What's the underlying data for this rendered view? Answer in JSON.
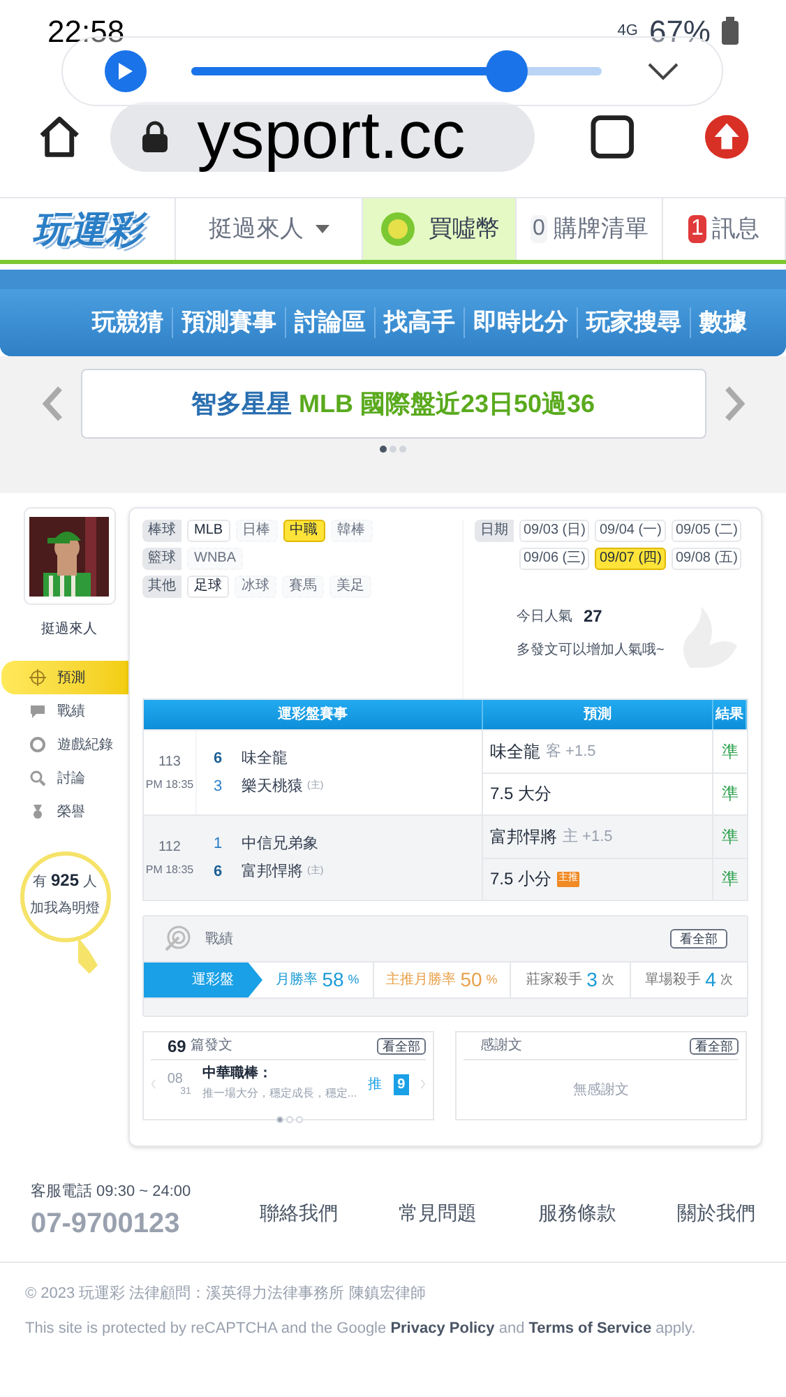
{
  "status_bar": {
    "time": "22:58",
    "network": "4G",
    "battery": "67%"
  },
  "media_player": {
    "level": 0.77
  },
  "browser": {
    "url": "ysport.cc"
  },
  "header": {
    "logo": "玩運彩",
    "user_menu": "挺過來人",
    "buy_coins": "買噓幣",
    "cart": {
      "count": "0",
      "label": "購牌清單"
    },
    "messages": {
      "count": "1",
      "label": "訊息"
    }
  },
  "main_nav": [
    "玩競猜",
    "預測賽事",
    "討論區",
    "找高手",
    "即時比分",
    "玩家搜尋",
    "數據"
  ],
  "banner": {
    "text": "智多星星 **MLB 國際盤近23日50過36**",
    "dots": [
      {
        "selected": true
      },
      {
        "selected": false
      },
      {
        "selected": false
      }
    ]
  },
  "profile": {
    "name": "挺過來人"
  },
  "sidebar": [
    {
      "label": "預測",
      "kind": "target",
      "selected": true
    },
    {
      "label": "戰績",
      "kind": "chat",
      "selected": false
    },
    {
      "label": "遊戲紀錄",
      "kind": "ring",
      "selected": false
    },
    {
      "label": "討論",
      "kind": "search",
      "selected": false
    },
    {
      "label": "榮譽",
      "kind": "medal",
      "selected": false
    }
  ],
  "fans": {
    "prefix": "有",
    "count": "925",
    "suffix": "人",
    "action": "加我為明燈"
  },
  "filters": [
    {
      "label": "棒球",
      "options": [
        {
          "label": "MLB",
          "disabled": false,
          "selected": false
        },
        {
          "label": "日棒",
          "disabled": true,
          "selected": false
        },
        {
          "label": "中職",
          "disabled": false,
          "selected": true
        },
        {
          "label": "韓棒",
          "disabled": true,
          "selected": false
        }
      ]
    },
    {
      "label": "籃球",
      "options": [
        {
          "label": "WNBA",
          "disabled": true,
          "selected": false
        }
      ]
    },
    {
      "label": "其他",
      "options": [
        {
          "label": "足球",
          "disabled": false,
          "selected": false
        },
        {
          "label": "冰球",
          "disabled": true,
          "selected": false
        },
        {
          "label": "賽馬",
          "disabled": true,
          "selected": false
        },
        {
          "label": "美足",
          "disabled": true,
          "selected": false
        }
      ]
    }
  ],
  "dates": {
    "label": "日期",
    "items": [
      {
        "label": "09/03 (日)",
        "selected": false
      },
      {
        "label": "09/04 (一)",
        "selected": false
      },
      {
        "label": "09/05 (二)",
        "selected": false
      },
      {
        "label": "09/06 (三)",
        "selected": false
      },
      {
        "label": "09/07 (四)",
        "selected": true
      },
      {
        "label": "09/08 (五)",
        "selected": false
      }
    ]
  },
  "popularity": {
    "label": "今日人氣",
    "value": "27",
    "hint": "多發文可以增加人氣哦~"
  },
  "predictions": {
    "columns": [
      "運彩盤賽事",
      "預測",
      "結果"
    ],
    "games": [
      {
        "number": "113",
        "time": "PM 18:35",
        "teams": [
          {
            "score": "6",
            "name": "味全龍",
            "winner": true
          },
          {
            "score": "3",
            "name": "樂天桃猿",
            "winner": false,
            "home_mark": "(主)"
          }
        ],
        "picks": [
          {
            "pick": "味全龍",
            "note": "客 +1.5",
            "result": "準"
          },
          {
            "pick": "7.5 大分",
            "result": "準"
          }
        ]
      },
      {
        "number": "112",
        "time": "PM 18:35",
        "teams": [
          {
            "score": "1",
            "name": "中信兄弟象",
            "winner": false
          },
          {
            "score": "6",
            "name": "富邦悍將",
            "winner": true,
            "home_mark": "(主)"
          }
        ],
        "picks": [
          {
            "pick": "富邦悍將",
            "note": "主 +1.5",
            "result": "準"
          },
          {
            "pick": "7.5 小分",
            "badge": "主推",
            "result": "準"
          }
        ]
      }
    ]
  },
  "record": {
    "title": "戰績",
    "view_all": "看全部",
    "tab": "運彩盤",
    "metrics": [
      {
        "label": "月勝率",
        "value": "58",
        "unit": "%",
        "color": "#1a9ad6"
      },
      {
        "label": "主推月勝率",
        "value": "50",
        "unit": "%",
        "color": "#e8a04a"
      },
      {
        "label": "莊家殺手",
        "value": "3",
        "unit": "次",
        "color": "#777777"
      },
      {
        "label": "單場殺手",
        "value": "4",
        "unit": "次",
        "color": "#777777"
      }
    ]
  },
  "posts": {
    "count": "69",
    "label": "篇發文",
    "view_all": "看全部",
    "items": [
      {
        "month": "08",
        "day": "31",
        "title": "中華職棒：",
        "excerpt": "推一場大分，穩定成長，穩定...",
        "push_label": "推",
        "push_count": "9"
      }
    ],
    "dots": [
      {
        "selected": true
      },
      {
        "selected": false
      },
      {
        "selected": false
      }
    ]
  },
  "thanks": {
    "title": "感謝文",
    "view_all": "看全部",
    "empty": "無感謝文"
  },
  "footer": {
    "phone_label": "客服電話 09:30 ~ 24:00",
    "phone": "07-9700123",
    "links": [
      "聯絡我們",
      "常見問題",
      "服務條款",
      "關於我們"
    ],
    "copyright": "© 2023 玩運彩 法律顧問：溪英得力法律事務所 陳鎮宏律師",
    "recaptcha": "This site is protected by reCAPTCHA and the Google **Privacy Policy** and **Terms of Service** apply."
  }
}
